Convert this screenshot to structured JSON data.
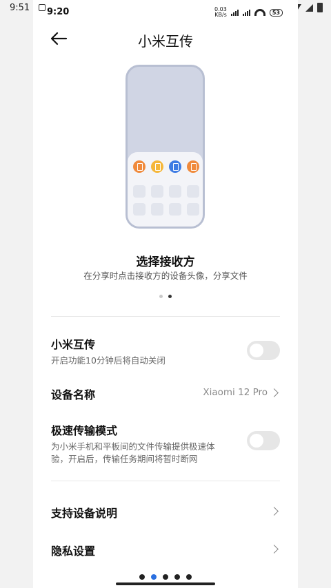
{
  "outer_status": {
    "time": "9:51"
  },
  "status": {
    "time": "9:20",
    "speed_top": "0.03",
    "speed_bottom": "KB/s",
    "battery": "53"
  },
  "header": {
    "title": "小米互传"
  },
  "illustration": {
    "app_colors": [
      "#f08a3c",
      "#f5b73a",
      "#3d7be3",
      "#f08a3c"
    ]
  },
  "intro": {
    "heading": "选择接收方",
    "subtitle": "在分享时点击接收方的设备头像，分享文件",
    "pages": 2,
    "active_page": 2
  },
  "settings": {
    "mi_share": {
      "label": "小米互传",
      "desc": "开启功能10分钟后将自动关闭",
      "enabled": false
    },
    "device_name": {
      "label": "设备名称",
      "value": "Xiaomi 12 Pro"
    },
    "fast_mode": {
      "label": "极速传输模式",
      "desc_line1": "为小米手机和平板间的文件传输提供极速体",
      "desc_line2": "验，开启后，传输任务期间将暂时断网",
      "enabled": false
    },
    "supported_devices": {
      "label": "支持设备说明"
    },
    "privacy": {
      "label": "隐私设置"
    }
  },
  "colors": {
    "accent": "#2a6fe0",
    "switch_off": "#e6e6e6"
  }
}
